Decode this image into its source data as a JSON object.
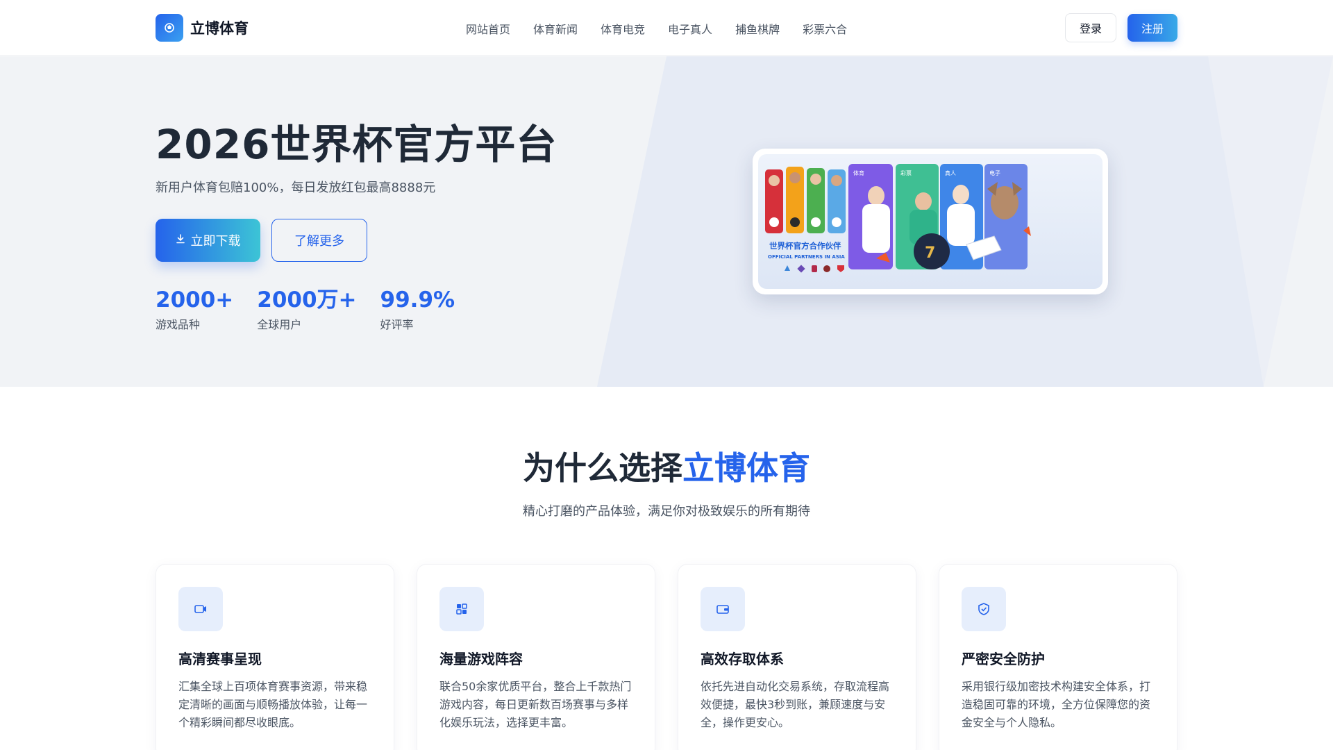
{
  "brand": {
    "name": "立博体育",
    "logo_icon": "sports-logo-icon"
  },
  "nav": {
    "items": [
      {
        "label": "网站首页"
      },
      {
        "label": "体育新闻"
      },
      {
        "label": "体育电竞"
      },
      {
        "label": "电子真人"
      },
      {
        "label": "捕鱼棋牌"
      },
      {
        "label": "彩票六合"
      }
    ]
  },
  "auth": {
    "login_label": "登录",
    "register_label": "注册"
  },
  "hero": {
    "title": "2026世界杯官方平台",
    "subtitle": "新用户体育包赔100%，每日发放红包最高8888元",
    "download_label": "立即下载",
    "download_icon": "download-icon",
    "more_label": "了解更多",
    "stats": [
      {
        "value": "2000+",
        "label": "游戏品种"
      },
      {
        "value": "2000万+",
        "label": "全球用户"
      },
      {
        "value": "99.9%",
        "label": "好评率"
      }
    ],
    "banner": {
      "headline": "世界杯官方合作伙伴",
      "tagline": "OFFICIAL PARTNERS IN ASIA",
      "tiles": [
        "体育",
        "彩票",
        "真人",
        "电子"
      ]
    }
  },
  "features": {
    "title_prefix": "为什么选择",
    "title_highlight": "立博体育",
    "subtitle": "精心打磨的产品体验，满足你对极致娱乐的所有期待",
    "cards": [
      {
        "icon": "hd-video-icon",
        "title": "高清赛事呈现",
        "desc": "汇集全球上百项体育赛事资源，带来稳定清晰的画面与顺畅播放体验，让每一个精彩瞬间都尽收眼底。"
      },
      {
        "icon": "games-grid-icon",
        "title": "海量游戏阵容",
        "desc": "联合50余家优质平台，整合上千款热门游戏内容，每日更新数百场赛事与多样化娱乐玩法，选择更丰富。"
      },
      {
        "icon": "wallet-icon",
        "title": "高效存取体系",
        "desc": "依托先进自动化交易系统，存取流程高效便捷，最快3秒到账，兼顾速度与安全，操作更安心。"
      },
      {
        "icon": "shield-icon",
        "title": "严密安全防护",
        "desc": "采用银行级加密技术构建安全体系，打造稳固可靠的环境，全方位保障您的资金安全与个人隐私。"
      }
    ]
  },
  "colors": {
    "accent": "#2563eb",
    "accent_2": "#3cc4d6",
    "hero_bg": "#f1f3f6",
    "text": "#1f2937"
  }
}
